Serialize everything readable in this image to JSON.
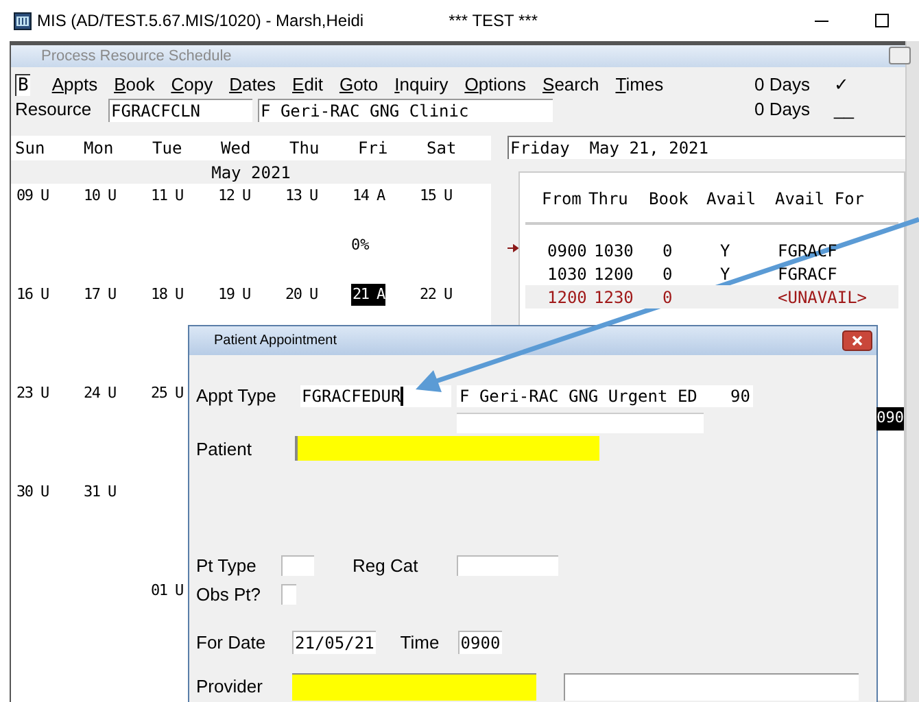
{
  "title_bar": {
    "title": "MIS (AD/TEST.5.67.MIS/1020) - Marsh,Heidi",
    "banner": "*** TEST ***"
  },
  "schedule_window": {
    "title": "Process Resource Schedule",
    "command": "B",
    "menu": [
      "Appts",
      "Book",
      "Copy",
      "Dates",
      "Edit",
      "Goto",
      "Inquiry",
      "Options",
      "Search",
      "Times"
    ],
    "resource": {
      "label": "Resource",
      "code": "FGRACFCLN",
      "name": "F Geri-RAC GNG Clinic"
    },
    "days": [
      {
        "value": "0 Days",
        "mark": "✓"
      },
      {
        "value": "0 Days",
        "mark": "__"
      }
    ]
  },
  "calendar": {
    "weekdays": [
      "Sun",
      "Mon",
      "Tue",
      "Wed",
      "Thu",
      "Fri",
      "Sat"
    ],
    "month": "May 2021",
    "weeks": [
      {
        "cells": [
          {
            "label": "09 U",
            "selected": false
          },
          {
            "label": "10 U",
            "selected": false
          },
          {
            "label": "11 U",
            "selected": false
          },
          {
            "label": "12 U",
            "selected": false
          },
          {
            "label": "13 U",
            "selected": false
          },
          {
            "label": "14 A",
            "selected": false,
            "note": "0%"
          },
          {
            "label": "15 U",
            "selected": false
          }
        ]
      },
      {
        "cells": [
          {
            "label": "16 U",
            "selected": false
          },
          {
            "label": "17 U",
            "selected": false
          },
          {
            "label": "18 U",
            "selected": false
          },
          {
            "label": "19 U",
            "selected": false
          },
          {
            "label": "20 U",
            "selected": false
          },
          {
            "label": "21 A",
            "selected": true
          },
          {
            "label": "22 U",
            "selected": false
          }
        ]
      },
      {
        "cells": [
          {
            "label": "23 U",
            "selected": false
          },
          {
            "label": "24 U",
            "selected": false
          },
          {
            "label": "25 U",
            "selected": false
          }
        ]
      },
      {
        "cells": [
          {
            "label": "30 U",
            "selected": false
          },
          {
            "label": "31 U",
            "selected": false
          }
        ]
      },
      {
        "cells": [
          null,
          null,
          {
            "label": "01 U",
            "selected": false
          }
        ]
      }
    ]
  },
  "day_view": {
    "date": "Friday  May 21, 2021",
    "columns": [
      "From",
      "Thru",
      "Book",
      "Avail",
      "Avail For"
    ],
    "rows": [
      {
        "from": "0900",
        "thru": "1030",
        "book": "0",
        "avail": "Y",
        "avail_for": "FGRACF",
        "current": true,
        "kind": "open"
      },
      {
        "from": "1030",
        "thru": "1200",
        "book": "0",
        "avail": "Y",
        "avail_for": "FGRACF",
        "current": false,
        "kind": "open"
      },
      {
        "from": "1200",
        "thru": "1230",
        "book": "0",
        "avail_for": "<UNAVAIL>",
        "current": false,
        "kind": "unavailable"
      }
    ],
    "time_label": "090"
  },
  "dialog": {
    "title": "Patient Appointment",
    "appt_type": {
      "label": "Appt Type",
      "code": "FGRACFEDUR",
      "description": "F Geri-RAC GNG Urgent ED",
      "duration": "90",
      "focused": true
    },
    "patient": {
      "label": "Patient",
      "highlighted": true
    },
    "pt_type": {
      "label": "Pt Type"
    },
    "reg_cat": {
      "label": "Reg Cat"
    },
    "obs_pt": {
      "label": "Obs Pt?",
      "checked": false
    },
    "for_date": {
      "label": "For Date",
      "value": "21/05/21"
    },
    "time": {
      "label": "Time",
      "value": "0900"
    },
    "provider": {
      "label": "Provider",
      "highlighted": true
    }
  }
}
